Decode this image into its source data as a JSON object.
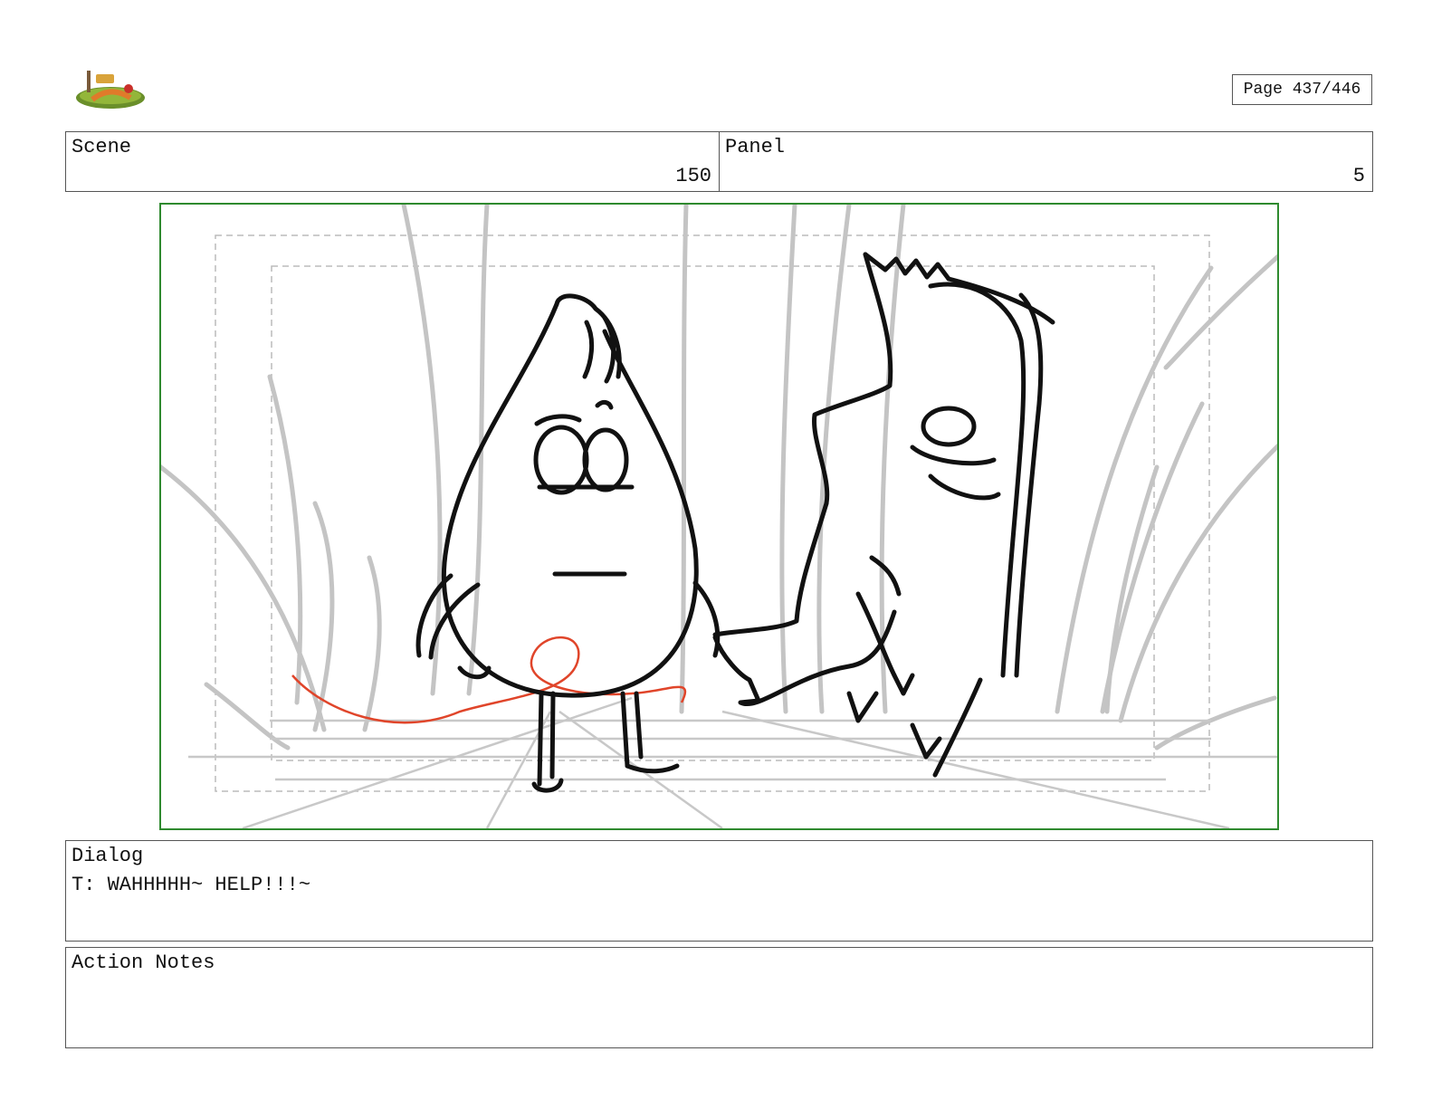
{
  "page": {
    "number_label": "Page 437/446"
  },
  "header": {
    "scene_label": "Scene",
    "scene_value": "150",
    "panel_label": "Panel",
    "panel_value": "5"
  },
  "dialog": {
    "label": "Dialog",
    "text": "T: WAHHHHH~ HELP!!!~"
  },
  "action_notes": {
    "label": "Action Notes",
    "text": ""
  },
  "colors": {
    "frame_border": "#2f8a2f",
    "box_border": "#555555",
    "sketch_line": "#111111",
    "background_sketch": "#bdbdbd",
    "rope": "#e0452a"
  },
  "icons": {
    "logo": "show-logo-icon"
  }
}
